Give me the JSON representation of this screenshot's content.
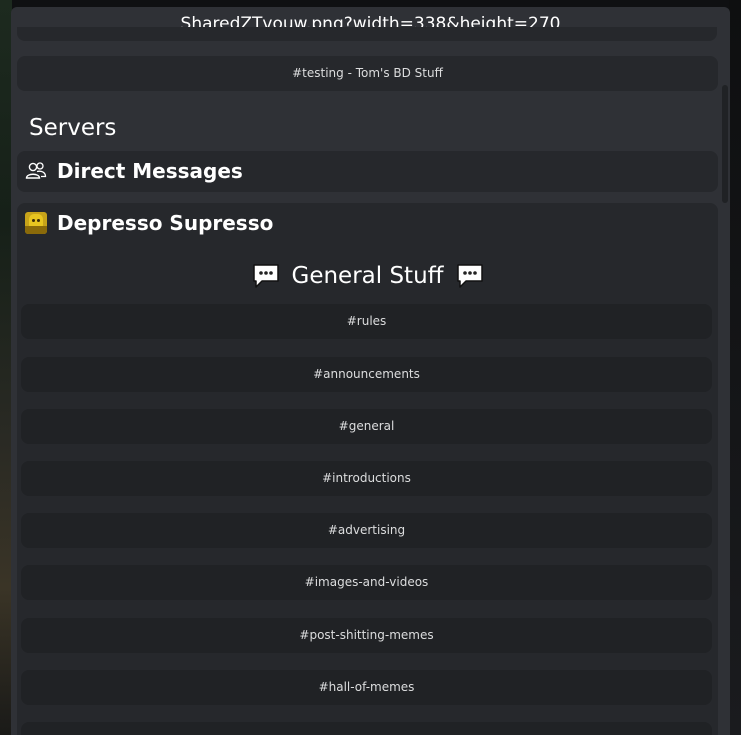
{
  "window": {
    "title": "SharedZTvouw.png?width=338&height=270"
  },
  "top_channel": {
    "label": "#testing - Tom's BD Stuff"
  },
  "servers_section": {
    "heading": "Servers"
  },
  "direct_messages": {
    "label": "Direct Messages",
    "icon": "people-icon"
  },
  "server": {
    "name": "Depresso Supresso",
    "icon": "server-avatar",
    "category": {
      "label": "General Stuff",
      "icon": "chat-bubble-icon",
      "channels": [
        {
          "label": "#rules"
        },
        {
          "label": "#announcements"
        },
        {
          "label": "#general"
        },
        {
          "label": "#introductions"
        },
        {
          "label": "#advertising"
        },
        {
          "label": "#images-and-videos"
        },
        {
          "label": "#post-shitting-memes"
        },
        {
          "label": "#hall-of-memes"
        }
      ]
    }
  },
  "colors": {
    "modal_bg": "#2f3136",
    "card_bg": "#26282c",
    "sub_card_bg": "#202225",
    "text_primary": "#ffffff",
    "text_secondary": "#dcddde"
  }
}
